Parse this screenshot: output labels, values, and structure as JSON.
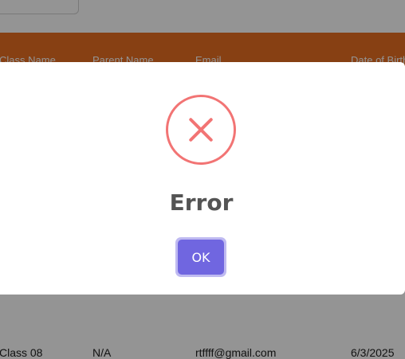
{
  "table": {
    "headers": [
      "Class Name",
      "Parent Name",
      "Email",
      "Date of Birth"
    ],
    "rows": [
      [
        "Class 08",
        "N/A",
        "rtffff@gmail.com",
        "6/3/2025"
      ]
    ]
  },
  "dialog": {
    "icon": "error-x-icon",
    "title": "Error",
    "ok_label": "OK"
  },
  "colors": {
    "table_header": "#e86f22",
    "error_icon": "#f27474",
    "ok_button": "#7066e0",
    "title_text": "#545454"
  }
}
